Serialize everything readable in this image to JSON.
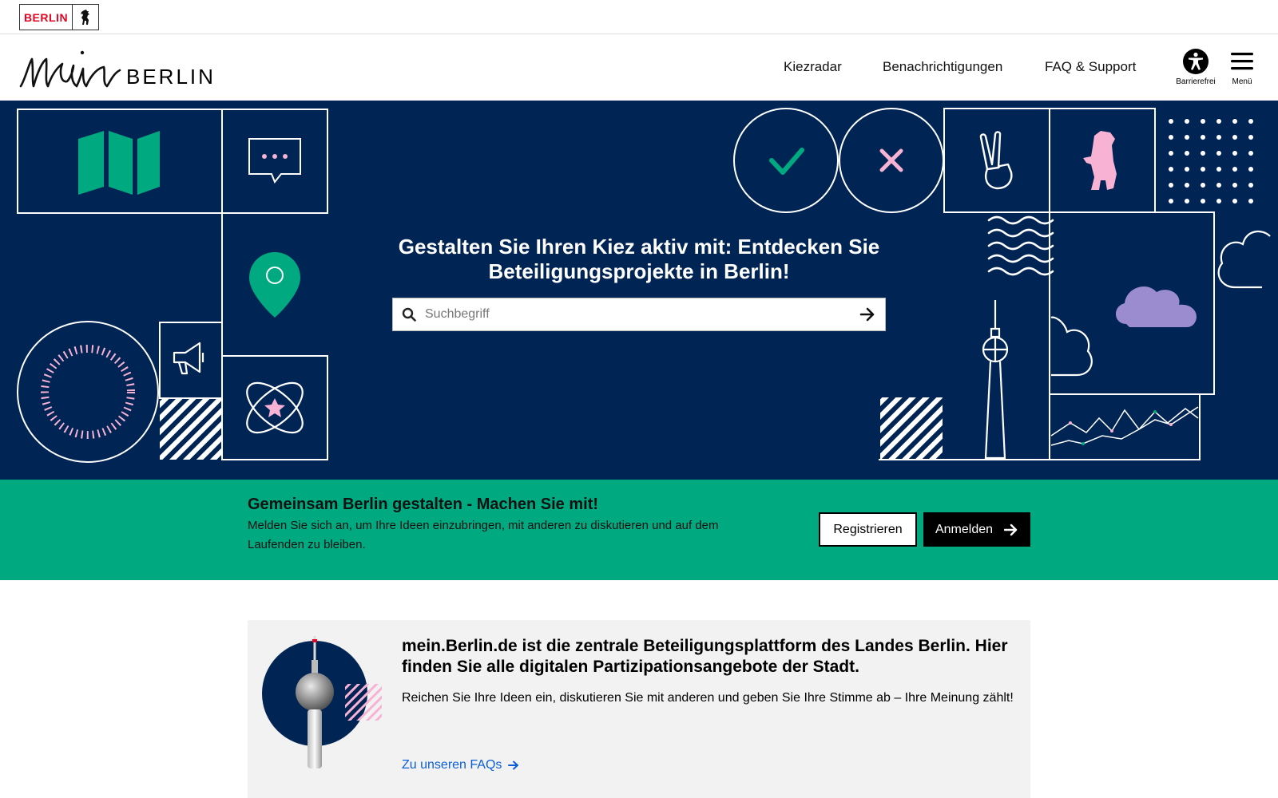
{
  "topbar": {
    "badge_text": "BERLIN"
  },
  "header": {
    "logo_script": "mein",
    "logo_word": "BERLIN",
    "nav": [
      "Kiezradar",
      "Benachrichtigungen",
      "FAQ & Support"
    ],
    "tools": {
      "accessibility_label": "Barrierefrei",
      "menu_label": "Menü"
    }
  },
  "hero": {
    "title": "Gestalten Sie Ihren Kiez aktiv mit: Entdecken Sie Beteiligungsprojekte in Berlin!",
    "search_placeholder": "Suchbegriff"
  },
  "cta": {
    "title": "Gemeinsam Berlin gestalten - Machen Sie mit!",
    "text": "Melden Sie sich an, um Ihre Ideen einzubringen, mit anderen zu diskutieren und auf dem Laufenden zu bleiben.",
    "register_label": "Registrieren",
    "login_label": "Anmelden"
  },
  "info": {
    "title": "mein.Berlin.de ist die zentrale Beteiligungsplattform des Landes Berlin. Hier finden Sie alle digitalen Partizipationsangebote der Stadt.",
    "description": "Reichen Sie Ihre Ideen ein, diskutieren Sie mit anderen und geben Sie Ihre Stimme ab – Ihre Meinung zählt!",
    "link_label": "Zu unseren FAQs"
  },
  "colors": {
    "navy": "#002454",
    "green": "#00a97f",
    "pink": "#f7b2d4",
    "purple": "#9b8ccf",
    "berlin_red": "#e40422",
    "link_blue": "#0a5fd8"
  }
}
